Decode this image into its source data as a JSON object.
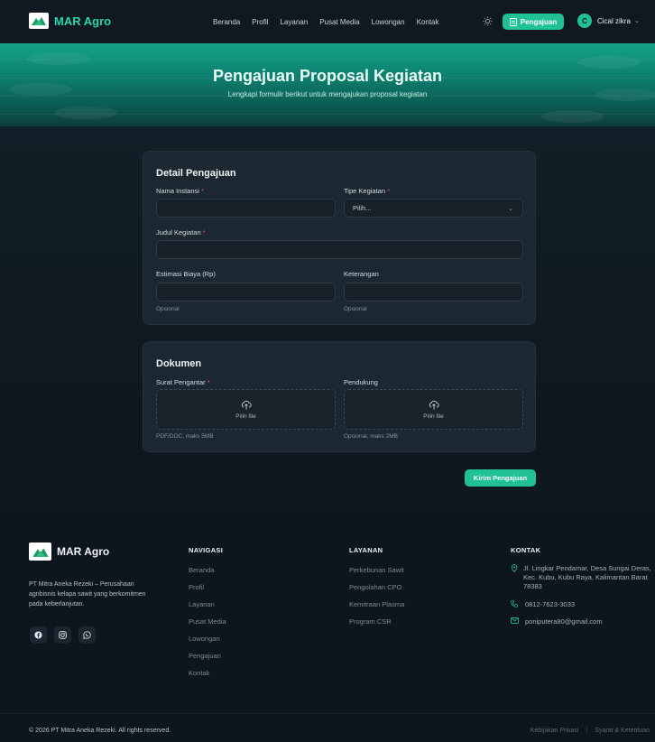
{
  "nav": {
    "brand": "MAR Agro",
    "links": [
      "Beranda",
      "Profil",
      "Layanan",
      "Pusat Media",
      "Lowongan",
      "Kontak"
    ],
    "cta_label": "Pengajuan",
    "user_initial": "C",
    "user_name": "Cical zikra"
  },
  "hero": {
    "title": "Pengajuan Proposal Kegiatan",
    "subtitle": "Lengkapi formulir berikut untuk mengajukan proposal kegiatan"
  },
  "detail": {
    "title": "Detail Pengajuan",
    "nama_instansi_label": "Nama Instansi",
    "tipe_kegiatan_label": "Tipe Kegiatan",
    "tipe_kegiatan_value": "Pilih...",
    "judul_kegiatan_label": "Judul Kegiatan",
    "estimasi_label": "Estimasi Biaya (Rp)",
    "keterangan_label": "Keterangan",
    "estimasi_hint": "Opsional",
    "keterangan_hint": "Opsional",
    "required_mark": "*"
  },
  "dokumen": {
    "title": "Dokumen",
    "surat_label": "Surat Pengantar",
    "pendukung_label": "Pendukung",
    "pick_file": "Pilih file",
    "surat_hint": "PDF/DOC, maks 5MB",
    "pendukung_hint": "Opsional, maks 2MB"
  },
  "submit_label": "Kirim Pengajuan",
  "footer": {
    "brand": "MAR Agro",
    "description": "PT Mitra Aneka Rezeki – Perusahaan agribisnis kelapa sawit yang berkomitmen pada keberlanjutan.",
    "nav_title": "NAVIGASI",
    "nav_links": [
      "Beranda",
      "Profil",
      "Layanan",
      "Pusat Media",
      "Lowongan",
      "Pengajuan",
      "Kontak"
    ],
    "layanan_title": "LAYANAN",
    "layanan_links": [
      "Perkebunan Sawit",
      "Pengolahan CPO",
      "Kemitraan Plasma",
      "Program CSR"
    ],
    "kontak_title": "KONTAK",
    "address": "Jl. Lingkar Pendamar, Desa Sungai Deras, Kec. Kubu, Kubu Raya, Kalimantan Barat 78383",
    "phone": "0812-7623-3033",
    "email": "poniputera80@gmail.com",
    "copyright": "© 2026 PT Mitra Aneka Rezeki. All rights reserved.",
    "privacy": "Kebijakan Privasi",
    "terms": "Syarat & Ketentuan"
  },
  "colors": {
    "accent": "#21c196",
    "background": "#0f1720",
    "card": "#1b2731",
    "required": "#ef4f5f"
  }
}
